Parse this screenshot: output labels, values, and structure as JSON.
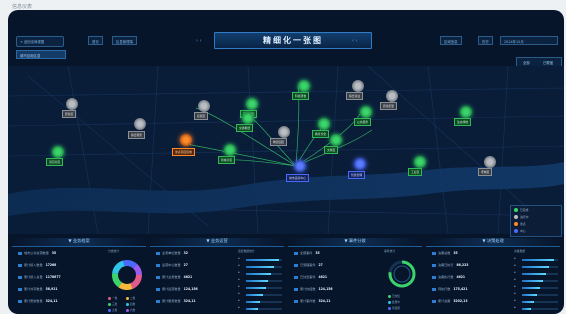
{
  "outer_title": "信息仪表",
  "header": {
    "left_label": "< 返回全局视图",
    "btn1": "首页",
    "btn2": "区县管理端",
    "title": "精细化一张图",
    "right_btn": "区域信息",
    "right_btn2": "历史",
    "date": "2024年10月",
    "filter": "城市应用区县"
  },
  "toggle": {
    "opt1": "全部",
    "opt2": "已覆盖"
  },
  "nodes": [
    {
      "id": "n1",
      "cls": "gr",
      "label": "居住区"
    },
    {
      "id": "n2",
      "cls": "gr",
      "label": "综合服务"
    },
    {
      "id": "n3",
      "cls": "gr",
      "label": "商贸区"
    },
    {
      "id": "n4",
      "cls": "g",
      "label": "产业园区"
    },
    {
      "id": "n5",
      "cls": "g",
      "label": "科技研发"
    },
    {
      "id": "n6",
      "cls": "g",
      "label": "教育文化"
    },
    {
      "id": "n7",
      "cls": "gr",
      "label": "综合商业"
    },
    {
      "id": "n8",
      "cls": "gr",
      "label": "居住配套"
    },
    {
      "id": "n9",
      "cls": "g",
      "label": "公共服务"
    },
    {
      "id": "n10",
      "cls": "g",
      "label": "交通枢纽"
    },
    {
      "id": "n11",
      "cls": "g",
      "label": "生态绿地"
    },
    {
      "id": "n12",
      "cls": "o",
      "label": "重点项目区域"
    },
    {
      "id": "n13",
      "cls": "g",
      "label": "滨河片区"
    },
    {
      "id": "n14",
      "cls": "b",
      "label": "城市运营中心"
    },
    {
      "id": "n15",
      "cls": "b",
      "label": "智慧管理"
    },
    {
      "id": "n16",
      "cls": "g",
      "label": "新城片区"
    },
    {
      "id": "n17",
      "cls": "g",
      "label": "工业区"
    },
    {
      "id": "n18",
      "cls": "gr",
      "label": "老城区"
    },
    {
      "id": "n19",
      "cls": "g",
      "label": "文旅区"
    },
    {
      "id": "n20",
      "cls": "gr",
      "label": "物流园区"
    }
  ],
  "legend": [
    {
      "label": "已完成",
      "color": "#3ad36c"
    },
    {
      "label": "进行中",
      "color": "#b9bec4"
    },
    {
      "label": "重点",
      "color": "#ff8a2a"
    },
    {
      "label": "中心",
      "color": "#4a6aff"
    }
  ],
  "panels": [
    {
      "title": "▼ 业务档案",
      "rows": [
        {
          "label": "城市公共资源数量",
          "value": "35"
        },
        {
          "label": "累计接入数量",
          "value": "17268"
        },
        {
          "label": "累计接入总量",
          "value": "1178677"
        },
        {
          "label": "累计共享数量",
          "value": "58,921"
        },
        {
          "label": "累计更新数量",
          "value": "324,11"
        }
      ],
      "chart_title": "分类统计",
      "legend": [
        "一类",
        "二类",
        "三类",
        "四类",
        "五类",
        "六类"
      ]
    },
    {
      "title": "▼ 业务运营",
      "rows": [
        {
          "label": "业务单位数量",
          "value": "32"
        },
        {
          "label": "运营中心数量",
          "value": "27"
        },
        {
          "label": "累计业务数量",
          "value": "4621"
        },
        {
          "label": "累计运营数量",
          "value": "124,156"
        },
        {
          "label": "累计服务数量",
          "value": "324,11"
        }
      ],
      "chart_title": "运营数据统计",
      "bars": [
        0.92,
        0.78,
        0.7,
        0.62,
        0.55,
        0.48,
        0.4,
        0.32
      ]
    },
    {
      "title": "▼ 事件分拨",
      "rows": [
        {
          "label": "全部事件",
          "value": "35"
        },
        {
          "label": "已受理事件",
          "value": "27"
        },
        {
          "label": "已处置事件",
          "value": "4621"
        },
        {
          "label": "累计办结数",
          "value": "124,156"
        },
        {
          "label": "累计事件数",
          "value": "324,11"
        }
      ],
      "chart_title": "事件统计",
      "legend": [
        "已办结",
        "处理中",
        "待受理"
      ]
    },
    {
      "title": "▼ 决策处理",
      "rows": [
        {
          "label": "决策总数",
          "value": "35"
        },
        {
          "label": "决策已执行",
          "value": "86,223"
        },
        {
          "label": "决策执行数",
          "value": "4621"
        },
        {
          "label": "待执行数",
          "value": "175,421"
        },
        {
          "label": "累计决策",
          "value": "3202,13"
        }
      ],
      "chart_title": "决策数据",
      "bars": [
        0.88,
        0.74,
        0.66,
        0.58,
        0.5,
        0.42,
        0.34,
        0.26
      ]
    }
  ]
}
